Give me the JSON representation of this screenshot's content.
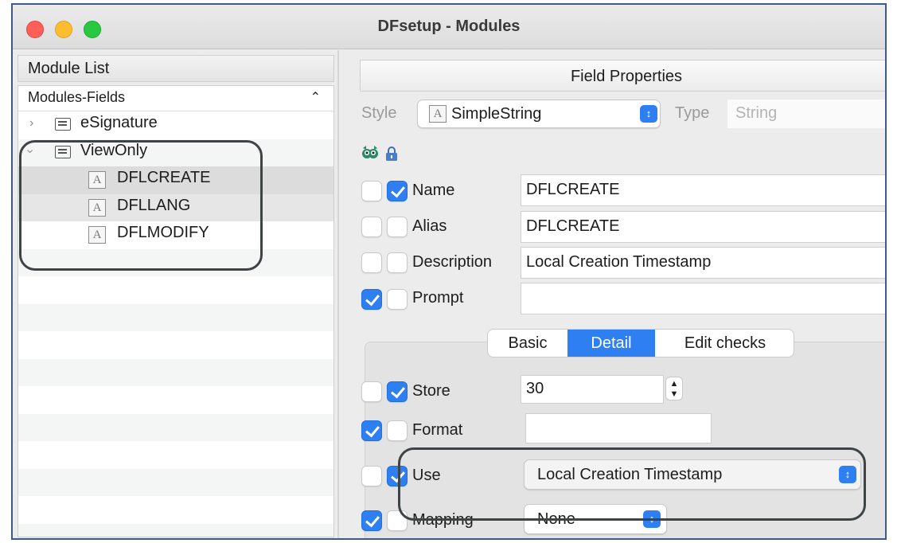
{
  "window": {
    "title": "DFsetup - Modules"
  },
  "module_list": {
    "header": "Module List",
    "column_header": "Modules-Fields",
    "sort_icon": "chevron-up-icon",
    "items": [
      {
        "label": "eSignature",
        "type": "module",
        "expanded": false
      },
      {
        "label": "ViewOnly",
        "type": "module",
        "expanded": true
      },
      {
        "label": "DFLCREATE",
        "type": "field",
        "selected": true
      },
      {
        "label": "DFLLANG",
        "type": "field"
      },
      {
        "label": "DFLMODIFY",
        "type": "field"
      }
    ]
  },
  "field_properties": {
    "header": "Field Properties",
    "style_label": "Style",
    "style_value": "SimpleString",
    "type_label": "Type",
    "type_value": "String",
    "rows": [
      {
        "label": "Name",
        "cb1": false,
        "cb2": true,
        "value": "DFLCREATE"
      },
      {
        "label": "Alias",
        "cb1": false,
        "cb2": false,
        "value": "DFLCREATE"
      },
      {
        "label": "Description",
        "cb1": false,
        "cb2": false,
        "value": "Local Creation Timestamp"
      },
      {
        "label": "Prompt",
        "cb1": true,
        "cb2": false,
        "value": ""
      }
    ],
    "tabs": [
      {
        "label": "Basic",
        "active": false
      },
      {
        "label": "Detail",
        "active": true
      },
      {
        "label": "Edit checks",
        "active": false
      }
    ],
    "detail": {
      "store": {
        "label": "Store",
        "cb1": false,
        "cb2": true,
        "value": "30"
      },
      "format": {
        "label": "Format",
        "cb1": true,
        "cb2": false,
        "value": ""
      },
      "use": {
        "label": "Use",
        "cb1": false,
        "cb2": true,
        "value": "Local Creation Timestamp"
      },
      "mapping": {
        "label": "Mapping",
        "cb1": true,
        "cb2": false,
        "value": "None"
      }
    }
  },
  "colors": {
    "accent": "#2d7ff2",
    "highlight_border": "#3e4346"
  }
}
